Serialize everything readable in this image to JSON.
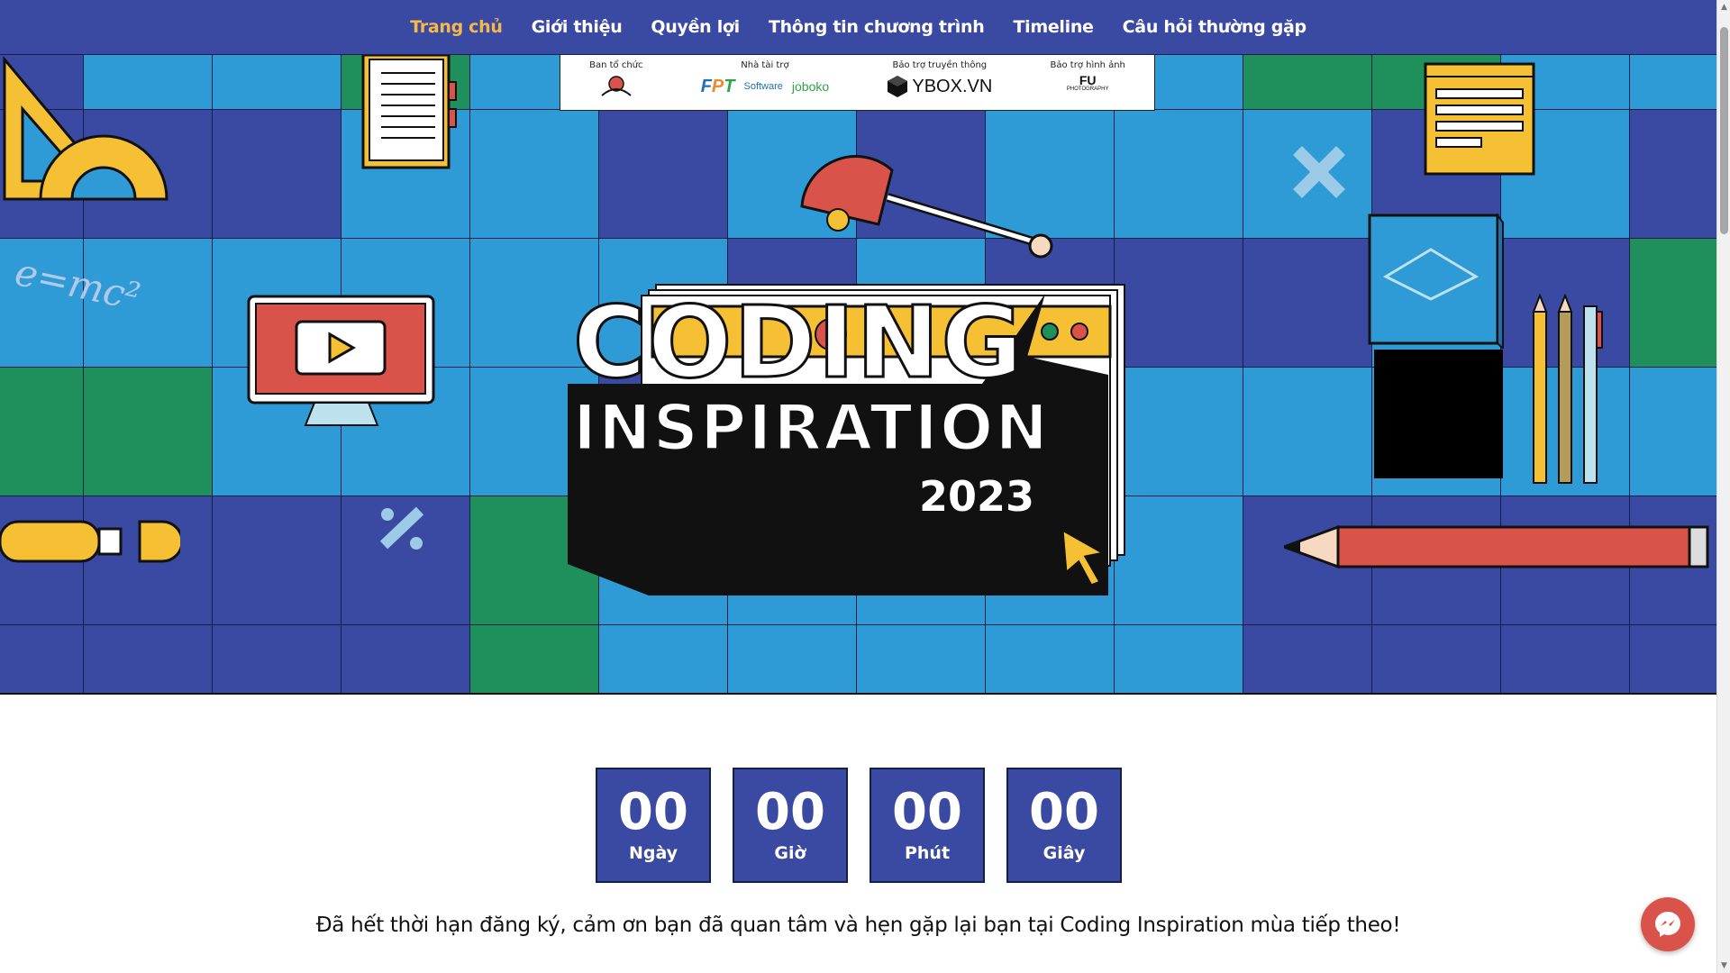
{
  "nav": {
    "items": [
      {
        "label": "Trang chủ",
        "active": true
      },
      {
        "label": "Giới thiệu",
        "active": false
      },
      {
        "label": "Quyền lợi",
        "active": false
      },
      {
        "label": "Thông tin chương trình",
        "active": false
      },
      {
        "label": "Timeline",
        "active": false
      },
      {
        "label": "Câu hỏi thường gặp",
        "active": false
      }
    ]
  },
  "sponsors": {
    "organizer_label": "Ban tổ chức",
    "sponsor_label": "Nhà tài trợ",
    "media_label": "Bảo trợ truyền thông",
    "image_label": "Bảo trợ hình ảnh",
    "fpt_software": "Software",
    "joboko": "joboko",
    "ybox": "YBOX.VN",
    "fu": "FU",
    "fu_sub": "PHOTOGRAPHY"
  },
  "hero": {
    "title_line1": "CODING",
    "title_line2": "INSPIRATION",
    "year": "2023",
    "formula": "e=mc²"
  },
  "countdown": [
    {
      "value": "00",
      "label": "Ngày"
    },
    {
      "value": "00",
      "label": "Giờ"
    },
    {
      "value": "00",
      "label": "Phút"
    },
    {
      "value": "00",
      "label": "Giây"
    }
  ],
  "closing_message": "Đã hết thời hạn đăng ký, cảm ơn bạn đã quan tâm và hẹn gặp lại bạn tại Coding Inspiration mùa tiếp theo!",
  "colors": {
    "nav_bg": "#3a4aa3",
    "active": "#f5b949",
    "hero_blue": "#2e9ad6",
    "hero_navy": "#3a4aa3",
    "hero_green": "#1f8f5c",
    "messenger": "#d9534a"
  }
}
